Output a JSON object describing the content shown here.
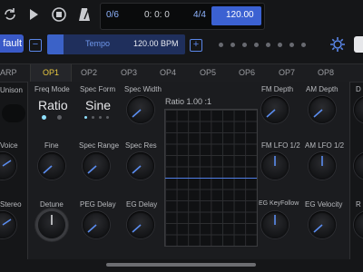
{
  "transport": {
    "position": "0/6",
    "time": "0: 0: 0",
    "meter": "4/4",
    "tempo": "120.00",
    "icons": [
      "loop-icon",
      "play-icon",
      "stop-icon",
      "metronome-icon"
    ]
  },
  "toolbar": {
    "preset_label": "fault",
    "minus": "−",
    "tempo_label": "Tempo",
    "tempo_value": "120.00 BPM",
    "plus": "+",
    "dot_count": 8
  },
  "tabs": [
    "ARP",
    "OP1",
    "OP2",
    "OP3",
    "OP4",
    "OP5",
    "OP6",
    "OP7",
    "OP8"
  ],
  "active_tab": "OP1",
  "left_strip": [
    "Unison",
    "Voice",
    "Stereo"
  ],
  "columns": {
    "freq_mode": {
      "label": "Freq Mode",
      "value": "Ratio"
    },
    "spec_form": {
      "label": "Spec Form",
      "value": "Sine"
    },
    "spec_width": "Spec Width",
    "fine": "Fine",
    "spec_range": "Spec Range",
    "spec_res": "Spec Res",
    "detune": "Detune",
    "peg_delay": "PEG Delay",
    "eg_delay": "EG Delay",
    "ratio_label": "Ratio 1.00 :1",
    "fm_depth": "FM Depth",
    "am_depth": "AM Depth",
    "fm_lfo": "FM LFO 1/2",
    "am_lfo": "AM LFO 1/2",
    "eg_keyfollow": "EG KeyFollow",
    "eg_velocity": "EG Velocity",
    "right_cut": [
      "D",
      "",
      "R"
    ]
  },
  "colors": {
    "accent": "#3b62c8",
    "active_tab": "#e8c840",
    "knob_indicator": "#5b8df0"
  }
}
